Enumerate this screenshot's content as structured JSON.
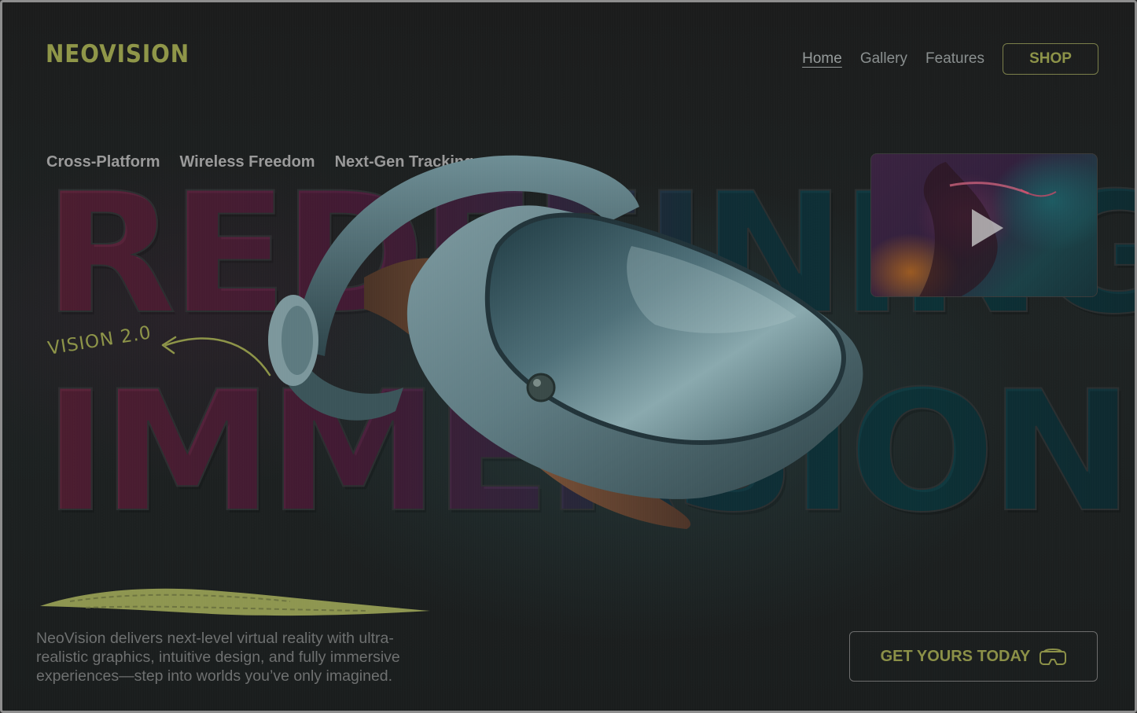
{
  "brand": {
    "name": "NEOVISION"
  },
  "nav": {
    "links": [
      {
        "label": "Home",
        "active": true
      },
      {
        "label": "Gallery",
        "active": false
      },
      {
        "label": "Features",
        "active": false
      }
    ],
    "shop_label": "SHOP"
  },
  "features": [
    "Cross-Platform",
    "Wireless Freedom",
    "Next-Gen Tracking"
  ],
  "headline": {
    "line1": "REDEFINING",
    "line2": "IMMERSION"
  },
  "tag": "VISION 2.0",
  "video": {
    "icon": "play-icon"
  },
  "description": "NeoVision delivers next-level virtual reality with ultra-realistic graphics, intuitive design, and fully immersive experiences—step into worlds you’ve only imagined.",
  "cta": {
    "label": "GET YOURS TODAY",
    "icon": "vr-headset-icon"
  },
  "colors": {
    "accent": "#8f9648",
    "background": "#1c1f1f",
    "muted_text": "#8a8f8f"
  }
}
